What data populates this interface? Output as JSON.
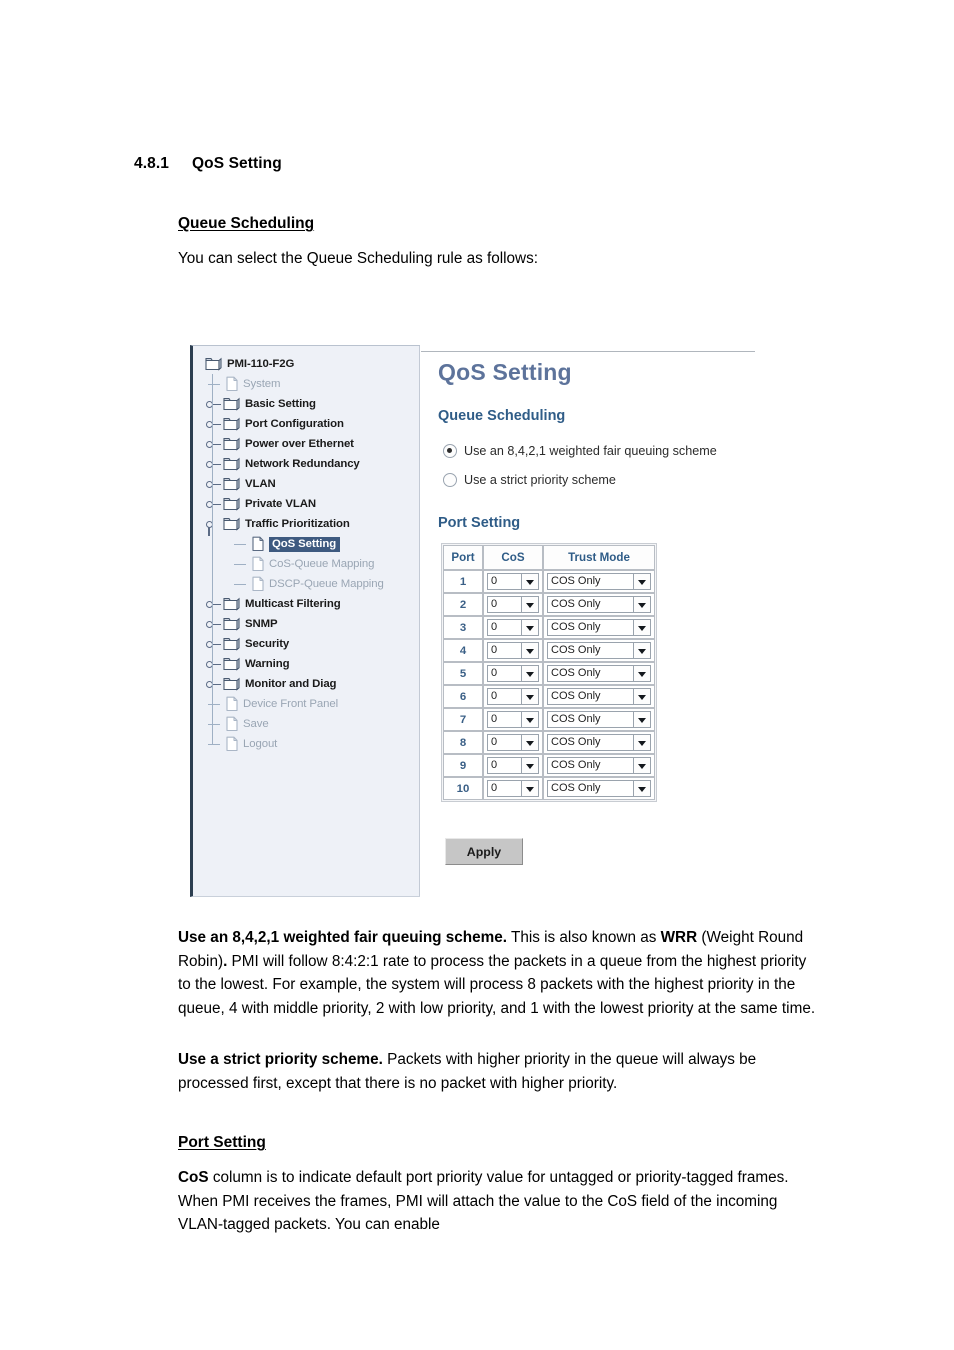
{
  "document": {
    "section_number": "4.8.1",
    "section_title": "QoS Setting",
    "queue_scheduling_heading": "Queue Scheduling",
    "intro_line": "You can select the Queue Scheduling rule as follows:",
    "port_setting_heading": "Port Setting",
    "paragraphs": {
      "wrr": {
        "lead": "Use an 8,4,2,1 weighted fair queuing scheme.",
        "mid1": " This is also known as ",
        "bold1": "WRR",
        "mid2": " (Weight Round Robin)",
        "bold2": ".",
        "rest": " PMI will follow 8:4:2:1 rate to process the packets in a queue from the highest priority to the lowest. For example, the system will process 8 packets with the highest priority in the queue, 4 with middle priority, 2 with low priority, and 1 with the lowest priority at the same time."
      },
      "strict": {
        "lead": "Use a strict priority scheme.",
        "rest": " Packets with higher priority in the queue will always be processed first, except that there is no packet with higher priority."
      },
      "cos": {
        "lead": "CoS",
        "rest": " column is to indicate default port priority value for untagged or priority-tagged frames. When PMI receives the frames, PMI will attach the value to the CoS field of the incoming VLAN-tagged packets. You can enable"
      }
    }
  },
  "screenshot": {
    "tree": {
      "root_label": "PMI-110-F2G",
      "items": [
        {
          "label": "System",
          "icon": "document-icon",
          "state": "dim",
          "depth": 1,
          "handle": "leaf"
        },
        {
          "label": "Basic Setting",
          "icon": "folder-icon",
          "state": "normal",
          "depth": 1,
          "handle": "collapsed"
        },
        {
          "label": "Port Configuration",
          "icon": "folder-icon",
          "state": "normal",
          "depth": 1,
          "handle": "collapsed"
        },
        {
          "label": "Power over Ethernet",
          "icon": "folder-icon",
          "state": "normal",
          "depth": 1,
          "handle": "collapsed"
        },
        {
          "label": "Network Redundancy",
          "icon": "folder-icon",
          "state": "normal",
          "depth": 1,
          "handle": "collapsed"
        },
        {
          "label": "VLAN",
          "icon": "folder-icon",
          "state": "normal",
          "depth": 1,
          "handle": "collapsed"
        },
        {
          "label": "Private VLAN",
          "icon": "folder-icon",
          "state": "normal",
          "depth": 1,
          "handle": "collapsed"
        },
        {
          "label": "Traffic Prioritization",
          "icon": "folder-icon",
          "state": "normal",
          "depth": 1,
          "handle": "expanded"
        },
        {
          "label": "QoS Setting",
          "icon": "document-icon",
          "state": "selected",
          "depth": 2,
          "handle": "leaf"
        },
        {
          "label": "CoS-Queue Mapping",
          "icon": "document-icon",
          "state": "dim",
          "depth": 2,
          "handle": "leaf"
        },
        {
          "label": "DSCP-Queue Mapping",
          "icon": "document-icon",
          "state": "dim",
          "depth": 2,
          "handle": "leaf"
        },
        {
          "label": "Multicast Filtering",
          "icon": "folder-icon",
          "state": "normal",
          "depth": 1,
          "handle": "collapsed"
        },
        {
          "label": "SNMP",
          "icon": "folder-icon",
          "state": "normal",
          "depth": 1,
          "handle": "collapsed"
        },
        {
          "label": "Security",
          "icon": "folder-icon",
          "state": "normal",
          "depth": 1,
          "handle": "collapsed"
        },
        {
          "label": "Warning",
          "icon": "folder-icon",
          "state": "normal",
          "depth": 1,
          "handle": "collapsed"
        },
        {
          "label": "Monitor and Diag",
          "icon": "folder-icon",
          "state": "normal",
          "depth": 1,
          "handle": "collapsed"
        },
        {
          "label": "Device Front Panel",
          "icon": "document-icon",
          "state": "dim",
          "depth": 1,
          "handle": "leaf"
        },
        {
          "label": "Save",
          "icon": "document-icon",
          "state": "dim",
          "depth": 1,
          "handle": "leaf"
        },
        {
          "label": "Logout",
          "icon": "document-icon",
          "state": "dim",
          "depth": 1,
          "handle": "leaf"
        }
      ]
    },
    "panel": {
      "title": "QoS Setting",
      "queue_scheduling": {
        "title": "Queue Scheduling",
        "options": [
          {
            "label": "Use an 8,4,2,1 weighted fair queuing scheme",
            "selected": true
          },
          {
            "label": "Use a strict priority scheme",
            "selected": false
          }
        ]
      },
      "port_setting": {
        "title": "Port Setting",
        "columns": [
          "Port",
          "CoS",
          "Trust Mode"
        ],
        "rows": [
          {
            "port": "1",
            "cos": "0",
            "trust": "COS Only"
          },
          {
            "port": "2",
            "cos": "0",
            "trust": "COS Only"
          },
          {
            "port": "3",
            "cos": "0",
            "trust": "COS Only"
          },
          {
            "port": "4",
            "cos": "0",
            "trust": "COS Only"
          },
          {
            "port": "5",
            "cos": "0",
            "trust": "COS Only"
          },
          {
            "port": "6",
            "cos": "0",
            "trust": "COS Only"
          },
          {
            "port": "7",
            "cos": "0",
            "trust": "COS Only"
          },
          {
            "port": "8",
            "cos": "0",
            "trust": "COS Only"
          },
          {
            "port": "9",
            "cos": "0",
            "trust": "COS Only"
          },
          {
            "port": "10",
            "cos": "0",
            "trust": "COS Only"
          }
        ],
        "apply_label": "Apply"
      }
    },
    "colors": {
      "panel_title": "#5d739b",
      "section_title": "#2f5c87",
      "selection": "#3e5a80",
      "sidebar_bg": "#eef1f7",
      "dim_text": "#9aa6b4"
    }
  }
}
